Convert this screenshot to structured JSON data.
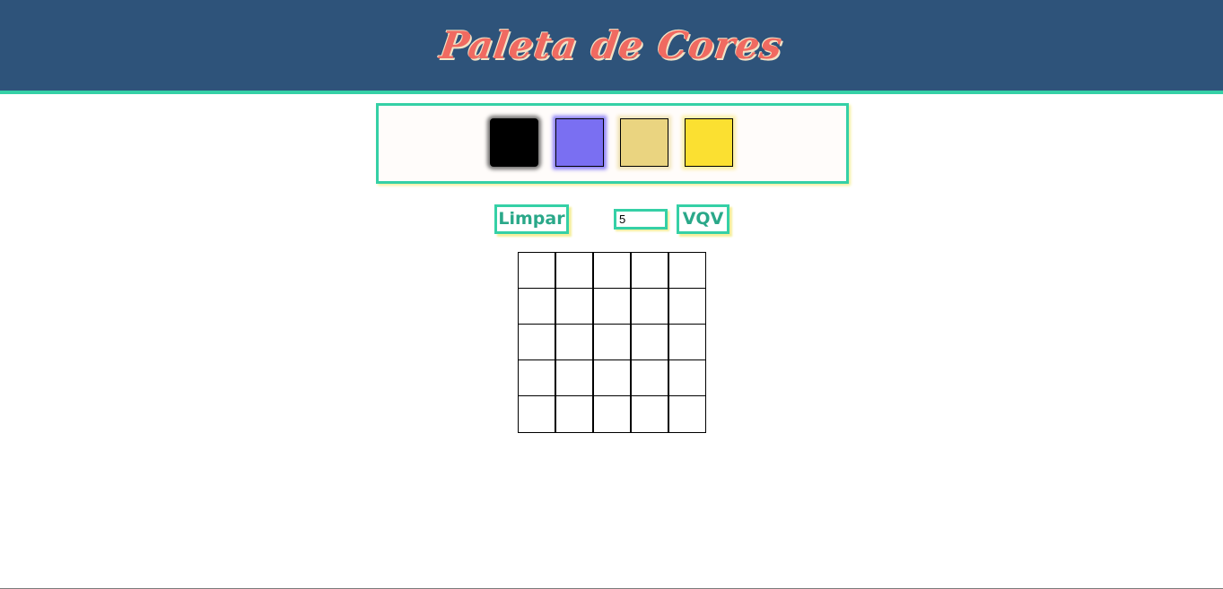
{
  "header": {
    "title": "Paleta de Cores",
    "background_color": "#2e537a",
    "accent_color": "#35d0a6",
    "title_color": "#f06a61"
  },
  "palette": {
    "colors": [
      "#000000",
      "#7a6ff2",
      "#ead480",
      "#fbe031"
    ],
    "selected_index": 0
  },
  "controls": {
    "clear_label": "Limpar",
    "board_size_value": "5",
    "generate_label": "VQV"
  },
  "board": {
    "rows": 5,
    "cols": 5,
    "pixel_color": "#ffffff"
  }
}
